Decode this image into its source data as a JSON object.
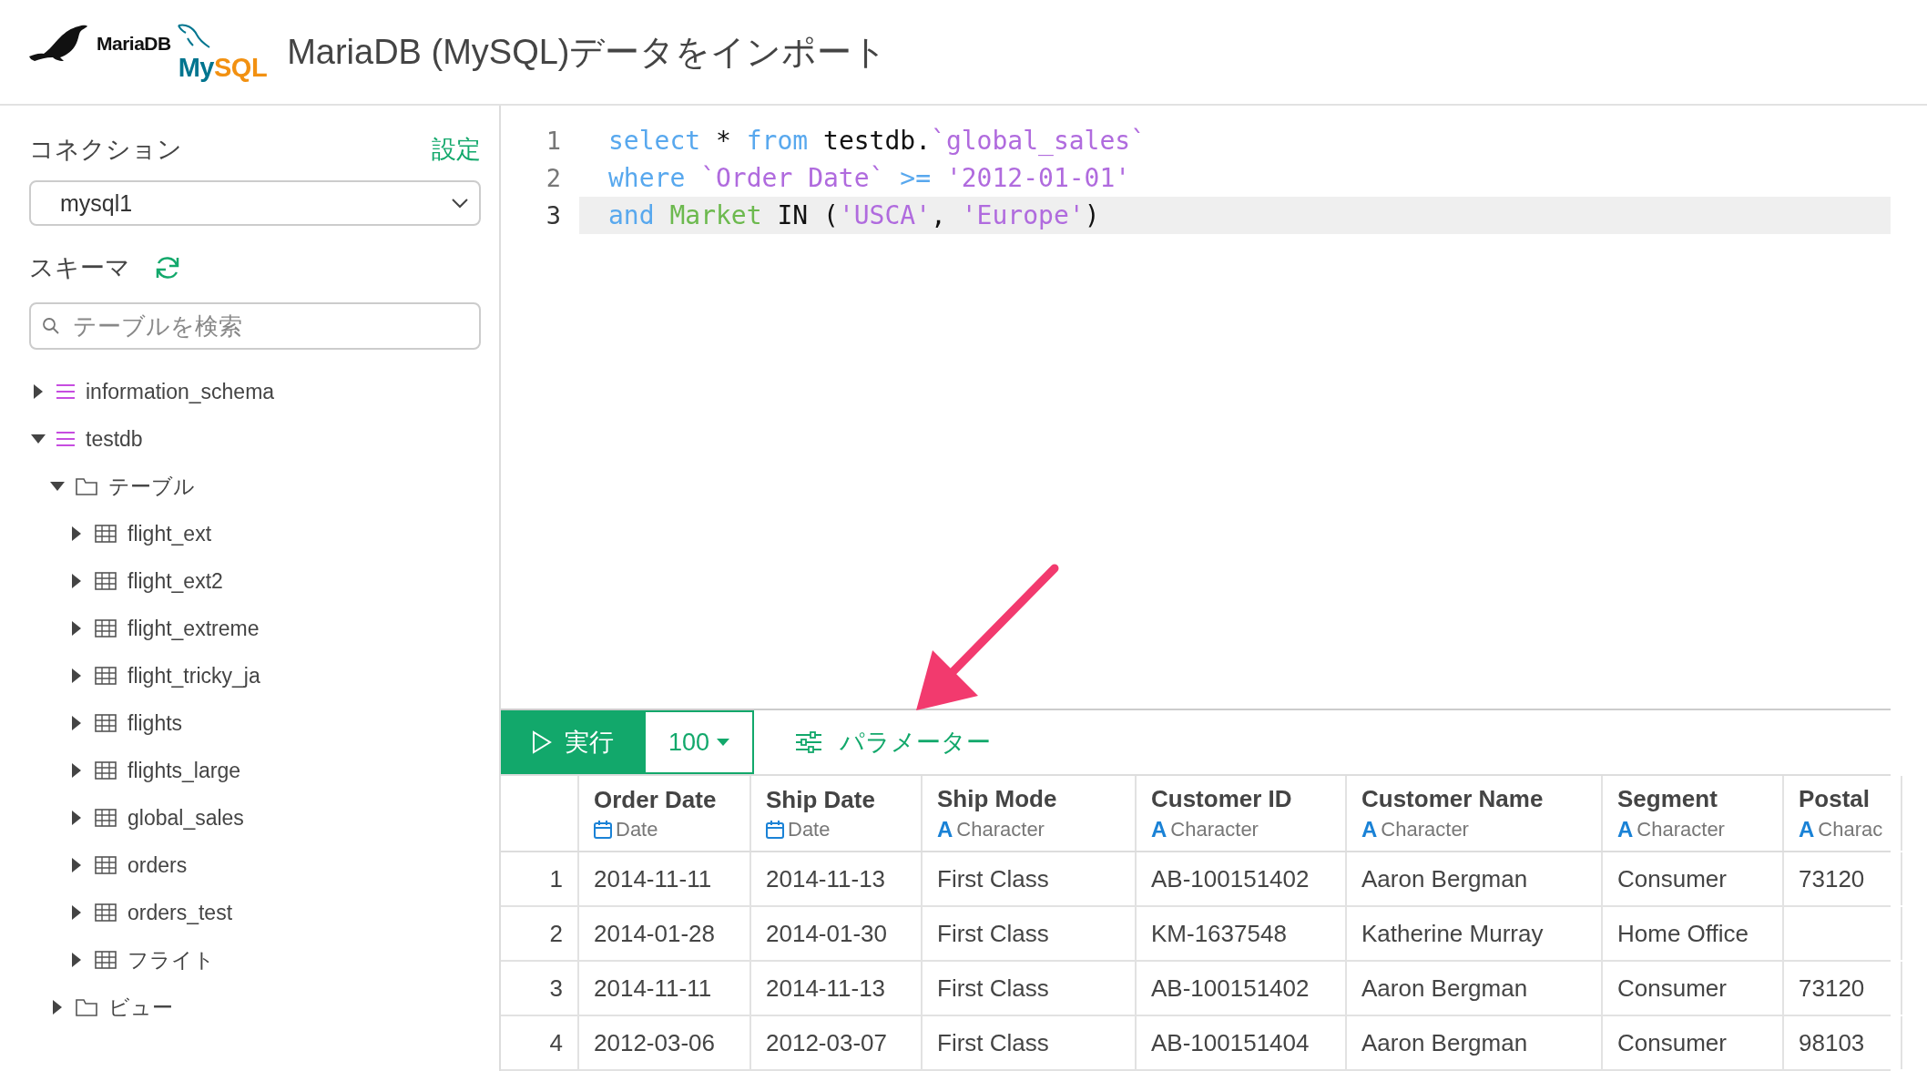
{
  "header": {
    "logo": {
      "mariadb": "MariaDB",
      "mysql_parts": [
        {
          "text": "My",
          "color": "#00758f"
        },
        {
          "text": "SQL",
          "color": "#f29111"
        }
      ]
    },
    "title": "MariaDB (MySQL)データをインポート"
  },
  "sidebar": {
    "connection_label": "コネクション",
    "settings_link": "設定",
    "connection_select": {
      "value": "mysql1"
    },
    "schema_label": "スキーマ",
    "search": {
      "placeholder": "テーブルを検索"
    },
    "tree": [
      {
        "kind": "schema",
        "label": "information_schema",
        "expanded": false
      },
      {
        "kind": "schema",
        "label": "testdb",
        "expanded": true,
        "children": [
          {
            "kind": "folder",
            "label": "テーブル",
            "expanded": true,
            "children": [
              {
                "kind": "table",
                "label": "flight_ext",
                "expanded": false
              },
              {
                "kind": "table",
                "label": "flight_ext2",
                "expanded": false
              },
              {
                "kind": "table",
                "label": "flight_extreme",
                "expanded": false
              },
              {
                "kind": "table",
                "label": "flight_tricky_ja",
                "expanded": false
              },
              {
                "kind": "table",
                "label": "flights",
                "expanded": false
              },
              {
                "kind": "table",
                "label": "flights_large",
                "expanded": false
              },
              {
                "kind": "table",
                "label": "global_sales",
                "expanded": false
              },
              {
                "kind": "table",
                "label": "orders",
                "expanded": false
              },
              {
                "kind": "table",
                "label": "orders_test",
                "expanded": false
              },
              {
                "kind": "table",
                "label": "フライト",
                "expanded": false
              }
            ]
          },
          {
            "kind": "folder",
            "label": "ビュー",
            "expanded": false
          }
        ]
      }
    ]
  },
  "editor": {
    "lines": [
      {
        "number": "1",
        "active": false,
        "tokens": [
          {
            "kind": "keyword",
            "text": "select"
          },
          {
            "kind": "plain",
            "text": " * "
          },
          {
            "kind": "keyword",
            "text": "from"
          },
          {
            "kind": "plain",
            "text": " testdb."
          },
          {
            "kind": "string",
            "text": "`global_sales`"
          }
        ]
      },
      {
        "number": "2",
        "active": false,
        "tokens": [
          {
            "kind": "keyword",
            "text": "where"
          },
          {
            "kind": "string",
            "text": " `Order Date`"
          },
          {
            "kind": "keyword",
            "text": " >="
          },
          {
            "kind": "string",
            "text": " '2012-01-01'"
          }
        ]
      },
      {
        "number": "3",
        "active": true,
        "tokens": [
          {
            "kind": "keyword",
            "text": "and"
          },
          {
            "kind": "field",
            "text": " Market"
          },
          {
            "kind": "plain",
            "text": " IN ("
          },
          {
            "kind": "string",
            "text": "'USCA'"
          },
          {
            "kind": "plain",
            "text": ", "
          },
          {
            "kind": "string",
            "text": "'Europe'"
          },
          {
            "kind": "plain",
            "text": ")"
          }
        ]
      }
    ]
  },
  "toolbar": {
    "run_button": "実行",
    "limit_select": "100",
    "parameters_button": "パラメーター"
  },
  "table": {
    "columns": [
      {
        "name": "Order Date",
        "kind": "date",
        "type": "Date"
      },
      {
        "name": "Ship Date",
        "kind": "date",
        "type": "Date"
      },
      {
        "name": "Ship Mode",
        "kind": "character",
        "type_icon": "A",
        "type": "Character"
      },
      {
        "name": "Customer ID",
        "kind": "character",
        "type_icon": "A",
        "type": "Character"
      },
      {
        "name": "Customer Name",
        "kind": "character",
        "type_icon": "A",
        "type": "Character"
      },
      {
        "name": "Segment",
        "kind": "character",
        "type_icon": "A",
        "type": "Character"
      },
      {
        "name": "Postal",
        "kind": "character",
        "type_icon": "A",
        "type": "Charac"
      }
    ],
    "rows": [
      {
        "number": "1",
        "cells": [
          "2014-11-11",
          "2014-11-13",
          "First Class",
          "AB-100151402",
          "Aaron Bergman",
          "Consumer",
          "73120"
        ]
      },
      {
        "number": "2",
        "cells": [
          "2014-01-28",
          "2014-01-30",
          "First Class",
          "KM-1637548",
          "Katherine Murray",
          "Home Office",
          ""
        ]
      },
      {
        "number": "3",
        "cells": [
          "2014-11-11",
          "2014-11-13",
          "First Class",
          "AB-100151402",
          "Aaron Bergman",
          "Consumer",
          "73120"
        ]
      },
      {
        "number": "4",
        "cells": [
          "2012-03-06",
          "2012-03-07",
          "First Class",
          "AB-100151404",
          "Aaron Bergman",
          "Consumer",
          "98103"
        ]
      }
    ]
  }
}
